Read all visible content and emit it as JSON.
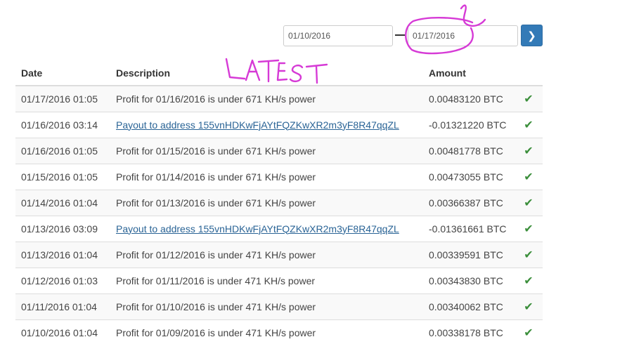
{
  "filter": {
    "from_date": "01/10/2016",
    "to_date": "01/17/2016",
    "go_icon": "chevron-right-icon"
  },
  "table": {
    "columns": [
      "Date",
      "Description",
      "Amount",
      ""
    ],
    "rows": [
      {
        "date": "01/17/2016 01:05",
        "description": "Profit for 01/16/2016 is under 671 KH/s power",
        "is_link": false,
        "amount": "0.00483120 BTC",
        "status": "check-icon"
      },
      {
        "date": "01/16/2016 03:14",
        "description": "Payout to address 155vnHDKwFjAYtFQZKwXR2m3yF8R47qqZL",
        "is_link": true,
        "amount": "-0.01321220 BTC",
        "status": "check-icon"
      },
      {
        "date": "01/16/2016 01:05",
        "description": "Profit for 01/15/2016 is under 671 KH/s power",
        "is_link": false,
        "amount": "0.00481778 BTC",
        "status": "check-icon"
      },
      {
        "date": "01/15/2016 01:05",
        "description": "Profit for 01/14/2016 is under 671 KH/s power",
        "is_link": false,
        "amount": "0.00473055 BTC",
        "status": "check-icon"
      },
      {
        "date": "01/14/2016 01:04",
        "description": "Profit for 01/13/2016 is under 671 KH/s power",
        "is_link": false,
        "amount": "0.00366387 BTC",
        "status": "check-icon"
      },
      {
        "date": "01/13/2016 03:09",
        "description": "Payout to address 155vnHDKwFjAYtFQZKwXR2m3yF8R47qqZL",
        "is_link": true,
        "amount": "-0.01361661 BTC",
        "status": "check-icon"
      },
      {
        "date": "01/13/2016 01:04",
        "description": "Profit for 01/12/2016 is under 471 KH/s power",
        "is_link": false,
        "amount": "0.00339591 BTC",
        "status": "check-icon"
      },
      {
        "date": "01/12/2016 01:03",
        "description": "Profit for 01/11/2016 is under 471 KH/s power",
        "is_link": false,
        "amount": "0.00343830 BTC",
        "status": "check-icon"
      },
      {
        "date": "01/11/2016 01:04",
        "description": "Profit for 01/10/2016 is under 471 KH/s power",
        "is_link": false,
        "amount": "0.00340062 BTC",
        "status": "check-icon"
      },
      {
        "date": "01/10/2016 01:04",
        "description": "Profit for 01/09/2016 is under 471 KH/s power",
        "is_link": false,
        "amount": "0.00338178 BTC",
        "status": "check-icon"
      }
    ]
  },
  "annotation": {
    "text": "LATEST",
    "color": "#d63ad6"
  },
  "colors": {
    "button": "#337ab7",
    "link": "#2a6496",
    "check": "#3c8f3c"
  }
}
